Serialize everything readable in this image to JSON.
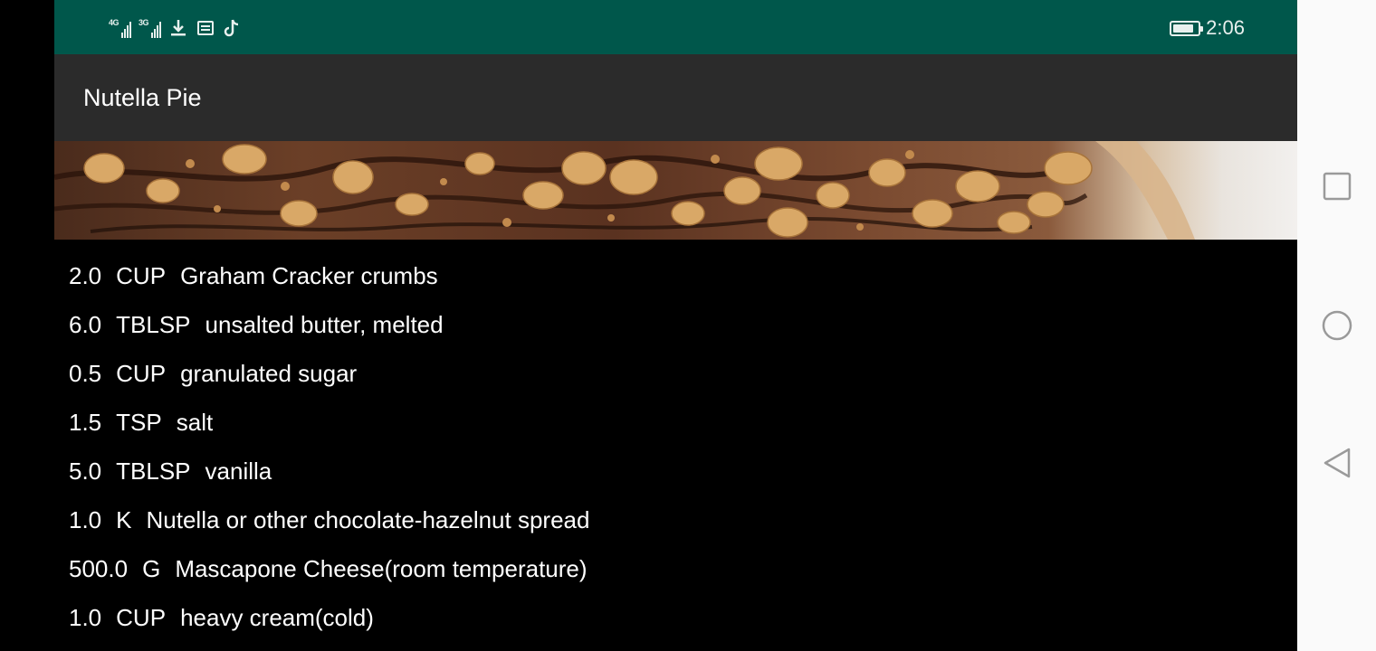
{
  "status_bar": {
    "network_1": "4G",
    "network_2": "3G",
    "time": "2:06",
    "icons": [
      "signal-4g-icon",
      "signal-3g-icon",
      "download-icon",
      "message-icon",
      "tiktok-icon",
      "battery-icon"
    ]
  },
  "app_bar": {
    "title": "Nutella Pie"
  },
  "hero": {
    "description_icon": "hero-image"
  },
  "ingredients": [
    {
      "quantity": "2.0",
      "unit": "CUP",
      "name": "Graham Cracker crumbs"
    },
    {
      "quantity": "6.0",
      "unit": "TBLSP",
      "name": "unsalted butter, melted"
    },
    {
      "quantity": "0.5",
      "unit": "CUP",
      "name": "granulated sugar"
    },
    {
      "quantity": "1.5",
      "unit": "TSP",
      "name": "salt"
    },
    {
      "quantity": "5.0",
      "unit": "TBLSP",
      "name": "vanilla"
    },
    {
      "quantity": "1.0",
      "unit": "K",
      "name": "Nutella or other chocolate-hazelnut spread"
    },
    {
      "quantity": "500.0",
      "unit": "G",
      "name": "Mascapone Cheese(room temperature)"
    },
    {
      "quantity": "1.0",
      "unit": "CUP",
      "name": "heavy cream(cold)"
    }
  ],
  "nav_bar": {
    "icons": [
      "recents-square-icon",
      "home-circle-icon",
      "back-triangle-icon"
    ]
  },
  "colors": {
    "status_bar": "#00574b",
    "app_bar": "#2b2b2b",
    "background": "#000000",
    "text": "#ffffff",
    "nav_bar": "#fafafa"
  }
}
